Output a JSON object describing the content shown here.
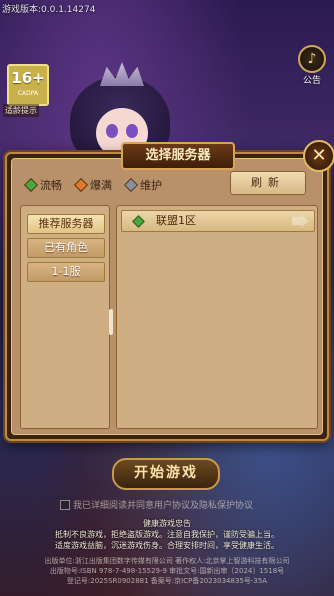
{
  "header": {
    "version_text": "游戏版本:0.0.1.14274",
    "age_rating": "16+",
    "age_org": "CADPA",
    "age_tip": "适龄提示",
    "notice_label": "公告",
    "notice_glyph": "♪"
  },
  "dialog": {
    "title": "选择服务器",
    "close_glyph": "✕",
    "legend": [
      {
        "label": "流畅",
        "color": "#4aa83a"
      },
      {
        "label": "爆满",
        "color": "#e07a28"
      },
      {
        "label": "维护",
        "color": "#8a8fa0"
      }
    ],
    "refresh_label": "刷新",
    "tabs": [
      {
        "label": "推荐服务器",
        "active": true
      },
      {
        "label": "已有角色",
        "active": false
      },
      {
        "label": "1-1服",
        "active": false
      }
    ],
    "servers": [
      {
        "name": "联盟1区",
        "status_color": "#4aa83a"
      }
    ]
  },
  "footer": {
    "start_label": "开始游戏",
    "agree_text": "我已详细阅读并同意用户协议及隐私保护协议",
    "health_title": "健康游戏忠告",
    "health_lines": [
      "抵制不良游戏，拒绝盗版游戏。注意自我保护，谨防受骗上当。",
      "适度游戏益脑，沉迷游戏伤身。合理安排时间，享受健康生活。"
    ],
    "pub_lines": [
      "出版单位:浙江出版集团数字传媒有限公司 著作权人:北京掌上智游科技有限公司",
      "出版物号:ISBN 978-7-498-15529-9 审批文号:国新出审〔2024〕1518号",
      "登记号:2025SR0902881 备案号:京ICP备2023034835号-35A"
    ]
  }
}
